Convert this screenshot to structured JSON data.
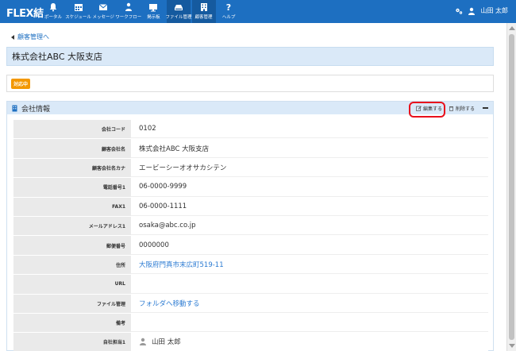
{
  "app": {
    "logo": "FLEX結"
  },
  "nav": [
    {
      "label": "ポータル",
      "icon": "bell-icon"
    },
    {
      "label": "スケジュール",
      "icon": "calendar-icon"
    },
    {
      "label": "メッセージ",
      "icon": "envelope-icon"
    },
    {
      "label": "ワークフロー",
      "icon": "workflow-icon"
    },
    {
      "label": "掲示板",
      "icon": "bulletin-icon"
    },
    {
      "label": "ファイル管理",
      "icon": "drive-icon"
    },
    {
      "label": "顧客管理",
      "icon": "building-icon"
    },
    {
      "label": "ヘルプ",
      "icon": "help-icon"
    }
  ],
  "user": {
    "name": "山田 太郎",
    "icon": "user-icon",
    "settings_icon": "gears-icon"
  },
  "breadcrumb": {
    "back_label": "顧客管理へ"
  },
  "page": {
    "title": "株式会社ABC 大阪支店",
    "status": "対応中"
  },
  "panel": {
    "title": "会社情報",
    "edit_label": "編集する",
    "delete_label": "削除する"
  },
  "rows": [
    {
      "label": "会社コード",
      "value": "0102"
    },
    {
      "label": "顧客会社名",
      "value": "株式会社ABC 大阪支店"
    },
    {
      "label": "顧客会社名カナ",
      "value": "エービーシーオオサカシテン"
    },
    {
      "label": "電話番号1",
      "value": "06-0000-9999"
    },
    {
      "label": "FAX1",
      "value": "06-0000-1111"
    },
    {
      "label": "メールアドレス1",
      "value": "osaka@abc.co.jp"
    },
    {
      "label": "郵便番号",
      "value": "0000000"
    },
    {
      "label": "住所",
      "value": "大阪府門真市末広町519-11"
    },
    {
      "label": "URL",
      "value": ""
    },
    {
      "label": "ファイル管理",
      "value": "フォルダへ移動する"
    },
    {
      "label": "備考",
      "value": ""
    },
    {
      "label": "自社担当1",
      "value": "山田 太郎"
    }
  ],
  "colors": {
    "topbar": "#1d6fc1",
    "badge": "#f39800",
    "link": "#2a7ad2",
    "highlight": "#e8101c"
  }
}
